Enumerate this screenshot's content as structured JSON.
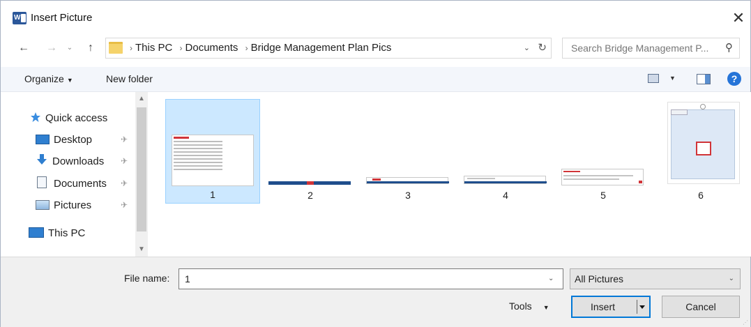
{
  "window": {
    "title": "Insert Picture",
    "close_glyph": "✕",
    "app_icon": "word-icon"
  },
  "nav": {
    "back_glyph": "←",
    "forward_glyph": "→",
    "recent_glyph": "⌄",
    "up_glyph": "↑"
  },
  "address": {
    "crumbs": [
      "This PC",
      "Documents",
      "Bridge Management Plan Pics"
    ],
    "separator": "›",
    "dropdown_glyph": "⌄",
    "refresh_glyph": "↻"
  },
  "search": {
    "placeholder": "Search Bridge Management P...",
    "icon_glyph": "⚲"
  },
  "toolbar": {
    "organize_label": "Organize",
    "caret": "▼",
    "new_folder_label": "New folder",
    "help_glyph": "?"
  },
  "sidebar": {
    "items": [
      {
        "label": "Quick access",
        "icon": "star-icon"
      },
      {
        "label": "Desktop",
        "icon": "desktop-icon",
        "pinned": true
      },
      {
        "label": "Downloads",
        "icon": "download-arrow-icon",
        "pinned": true
      },
      {
        "label": "Documents",
        "icon": "document-icon",
        "pinned": true
      },
      {
        "label": "Pictures",
        "icon": "pictures-icon",
        "pinned": true
      },
      {
        "label": "This PC",
        "icon": "computer-icon"
      }
    ],
    "pin_glyph": "✈",
    "scroll_up_glyph": "▲",
    "scroll_down_glyph": "▼"
  },
  "files": [
    {
      "label": "1",
      "selected": true
    },
    {
      "label": "2",
      "selected": false
    },
    {
      "label": "3",
      "selected": false
    },
    {
      "label": "4",
      "selected": false
    },
    {
      "label": "5",
      "selected": false
    },
    {
      "label": "6",
      "selected": false
    }
  ],
  "footer": {
    "file_name_label": "File name:",
    "file_name_value": "1",
    "file_type_value": "All Pictures",
    "dropdown_glyph": "⌄",
    "tools_label": "Tools",
    "tools_caret": "▼",
    "insert_label": "Insert",
    "cancel_label": "Cancel"
  },
  "colors": {
    "accent": "#0078d7",
    "selection": "#cce8ff",
    "toolbar_bg": "#f3f6fb",
    "footer_bg": "#f0f0f0",
    "help_blue": "#2574d8"
  }
}
